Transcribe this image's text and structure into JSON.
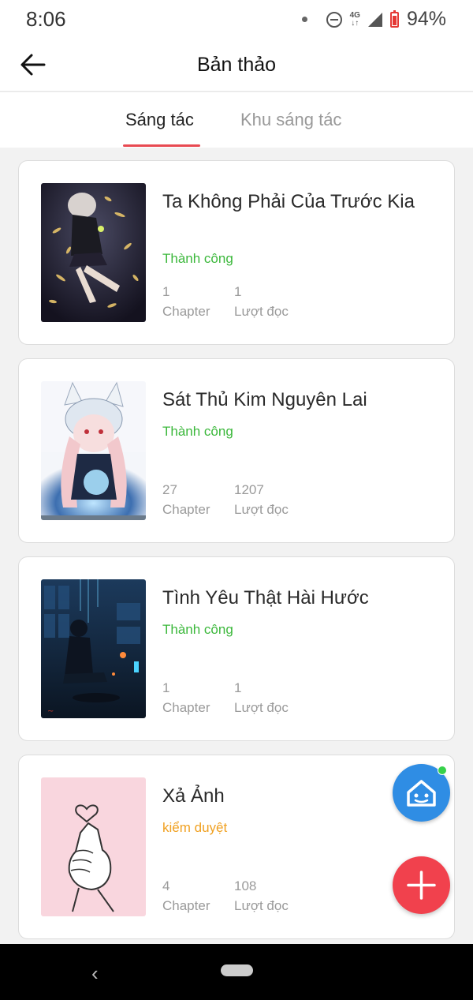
{
  "status_bar": {
    "time": "8:06",
    "network": "4G",
    "battery": "94%"
  },
  "header": {
    "title": "Bản thảo"
  },
  "tabs": [
    {
      "label": "Sáng tác",
      "active": true
    },
    {
      "label": "Khu sáng tác",
      "active": false
    }
  ],
  "stories": [
    {
      "title": "Ta Không Phải Của Trước Kia",
      "status": "Thành công",
      "status_color": "#3cb83c",
      "chapters": "1",
      "chapters_label": "Chapter",
      "reads": "1",
      "reads_label": "Lượt đọc"
    },
    {
      "title": "Sát Thủ Kim Nguyên Lai",
      "status": "Thành công",
      "status_color": "#3cb83c",
      "chapters": "27",
      "chapters_label": "Chapter",
      "reads": "1207",
      "reads_label": "Lượt đọc"
    },
    {
      "title": "Tình Yêu Thật Hài Hước",
      "status": "Thành công",
      "status_color": "#3cb83c",
      "chapters": "1",
      "chapters_label": "Chapter",
      "reads": "1",
      "reads_label": "Lượt đọc"
    },
    {
      "title": "Xả Ảnh",
      "status": "kiểm duyệt",
      "status_color": "#f0a020",
      "chapters": "4",
      "chapters_label": "Chapter",
      "reads": "108",
      "reads_label": "Lượt đọc"
    }
  ],
  "fabs": {
    "home_icon": "house-icon",
    "add_icon": "plus-icon"
  },
  "colors": {
    "accent": "#e84a52",
    "fab_blue": "#2f8de4",
    "fab_red": "#f1414d"
  }
}
